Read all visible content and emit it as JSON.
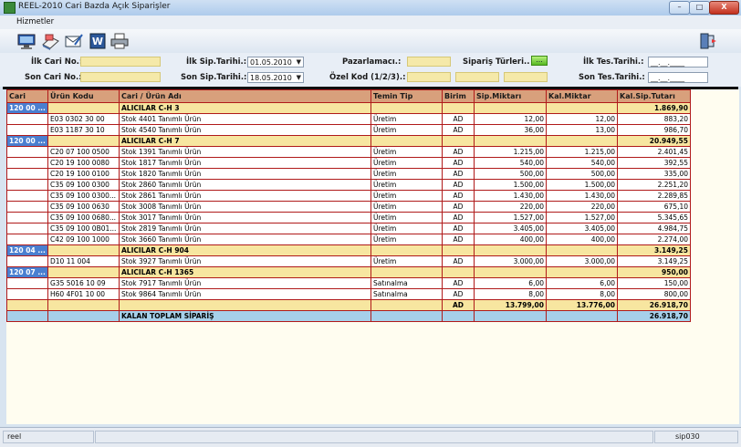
{
  "window": {
    "title": "REEL-2010 Cari Bazda Açık Siparişler",
    "min": "–",
    "max": "□",
    "close": "X"
  },
  "menu": {
    "hizmetler": "Hizmetler"
  },
  "toolbar": {
    "icons": [
      "monitor-icon",
      "document-icon",
      "envelope-icon",
      "word-icon",
      "printer-icon"
    ],
    "right_icon": "exit-door-icon"
  },
  "filters": {
    "ilk_cari_label": "İlk Cari No.:",
    "ilk_cari_value": "__ __ ____",
    "son_cari_label": "Son Cari No.:",
    "son_cari_value": "__ __ ____",
    "ilk_sip_label": "İlk Sip.Tarihi.:",
    "ilk_sip_value": "01.05.2010",
    "son_sip_label": "Son Sip.Tarihi.:",
    "son_sip_value": "18.05.2010",
    "pazarlamaci_label": "Pazarlamacı.:",
    "pazarlamaci_value": "__ __",
    "siparis_turleri_label": "Sipariş Türleri..",
    "siparis_turleri_btn": "...",
    "ozel_kod_label": "Özel Kod (1/2/3).:",
    "ozel_kod_values": [
      "____",
      "____",
      "____"
    ],
    "ilk_tes_label": "İlk Tes.Tarihi.:",
    "ilk_tes_value": "__.__.____",
    "son_tes_label": "Son Tes.Tarihi.:",
    "son_tes_value": "__.__.____"
  },
  "table": {
    "columns": [
      "Cari",
      "Ürün Kodu",
      "Cari / Ürün Adı",
      "Temin Tip",
      "Birim",
      "Sip.Miktarı",
      "Kal.Miktar",
      "Kal.Sip.Tutarı"
    ],
    "rows": [
      {
        "type": "group",
        "cari": "120 00 ...",
        "kod": "",
        "ad": "ALICILAR C-H 3",
        "temin": "",
        "birim": "",
        "sip": "",
        "kal": "",
        "tutar": "1.869,90"
      },
      {
        "type": "item",
        "cari": "",
        "kod": "E03 0302 30 00",
        "ad": "Stok 4401 Tanımlı Ürün",
        "temin": "Üretim",
        "birim": "AD",
        "sip": "12,00",
        "kal": "12,00",
        "tutar": "883,20"
      },
      {
        "type": "item",
        "cari": "",
        "kod": "E03 1187 30 10",
        "ad": "Stok 4540 Tanımlı Ürün",
        "temin": "Üretim",
        "birim": "AD",
        "sip": "36,00",
        "kal": "13,00",
        "tutar": "986,70"
      },
      {
        "type": "group",
        "cari": "120 00 ...",
        "kod": "",
        "ad": "ALICILAR C-H 7",
        "temin": "",
        "birim": "",
        "sip": "",
        "kal": "",
        "tutar": "20.949,55"
      },
      {
        "type": "item",
        "cari": "",
        "kod": "C20 07 100 0500",
        "ad": "Stok 1391 Tanımlı Ürün",
        "temin": "Üretim",
        "birim": "AD",
        "sip": "1.215,00",
        "kal": "1.215,00",
        "tutar": "2.401,45"
      },
      {
        "type": "item",
        "cari": "",
        "kod": "C20 19 100 0080",
        "ad": "Stok 1817 Tanımlı Ürün",
        "temin": "Üretim",
        "birim": "AD",
        "sip": "540,00",
        "kal": "540,00",
        "tutar": "392,55"
      },
      {
        "type": "item",
        "cari": "",
        "kod": "C20 19 100 0100",
        "ad": "Stok 1820 Tanımlı Ürün",
        "temin": "Üretim",
        "birim": "AD",
        "sip": "500,00",
        "kal": "500,00",
        "tutar": "335,00"
      },
      {
        "type": "item",
        "cari": "",
        "kod": "C35 09 100 0300",
        "ad": "Stok 2860 Tanımlı Ürün",
        "temin": "Üretim",
        "birim": "AD",
        "sip": "1.500,00",
        "kal": "1.500,00",
        "tutar": "2.251,20"
      },
      {
        "type": "item",
        "cari": "",
        "kod": "C35 09 100 0300...",
        "ad": "Stok 2861 Tanımlı Ürün",
        "temin": "Üretim",
        "birim": "AD",
        "sip": "1.430,00",
        "kal": "1.430,00",
        "tutar": "2.289,85"
      },
      {
        "type": "item",
        "cari": "",
        "kod": "C35 09 100 0630",
        "ad": "Stok 3008 Tanımlı Ürün",
        "temin": "Üretim",
        "birim": "AD",
        "sip": "220,00",
        "kal": "220,00",
        "tutar": "675,10"
      },
      {
        "type": "item",
        "cari": "",
        "kod": "C35 09 100 0680...",
        "ad": "Stok 3017 Tanımlı Ürün",
        "temin": "Üretim",
        "birim": "AD",
        "sip": "1.527,00",
        "kal": "1.527,00",
        "tutar": "5.345,65"
      },
      {
        "type": "item",
        "cari": "",
        "kod": "C35 09 100 0B01...",
        "ad": "Stok 2819 Tanımlı Ürün",
        "temin": "Üretim",
        "birim": "AD",
        "sip": "3.405,00",
        "kal": "3.405,00",
        "tutar": "4.984,75"
      },
      {
        "type": "item",
        "cari": "",
        "kod": "C42 09 100 1000",
        "ad": "Stok 3660 Tanımlı Ürün",
        "temin": "Üretim",
        "birim": "AD",
        "sip": "400,00",
        "kal": "400,00",
        "tutar": "2.274,00"
      },
      {
        "type": "group",
        "cari": "120 04 ...",
        "kod": "",
        "ad": "ALICILAR C-H 904",
        "temin": "",
        "birim": "",
        "sip": "",
        "kal": "",
        "tutar": "3.149,25"
      },
      {
        "type": "item",
        "cari": "",
        "kod": "D10 11 004",
        "ad": "Stok 3927 Tanımlı Ürün",
        "temin": "Üretim",
        "birim": "AD",
        "sip": "3.000,00",
        "kal": "3.000,00",
        "tutar": "3.149,25"
      },
      {
        "type": "group",
        "cari": "120 07 ...",
        "kod": "",
        "ad": "ALICILAR C-H 1365",
        "temin": "",
        "birim": "",
        "sip": "",
        "kal": "",
        "tutar": "950,00"
      },
      {
        "type": "item",
        "cari": "",
        "kod": "G35 5016 10 09",
        "ad": "Stok 7917 Tanımlı Ürün",
        "temin": "Satınalma",
        "birim": "AD",
        "sip": "6,00",
        "kal": "6,00",
        "tutar": "150,00"
      },
      {
        "type": "item",
        "cari": "",
        "kod": "H60 4F01 10 00",
        "ad": "Stok 9864 Tanımlı Ürün",
        "temin": "Satınalma",
        "birim": "AD",
        "sip": "8,00",
        "kal": "8,00",
        "tutar": "800,00"
      },
      {
        "type": "total",
        "cari": "",
        "kod": "",
        "ad": "",
        "temin": "",
        "birim": "AD",
        "sip": "13.799,00",
        "kal": "13.776,00",
        "tutar": "26.918,70"
      },
      {
        "type": "grand",
        "cari": "",
        "kod": "",
        "ad": "KALAN TOPLAM SİPARİŞ",
        "temin": "",
        "birim": "",
        "sip": "",
        "kal": "",
        "tutar": "26.918,70"
      }
    ]
  },
  "status": {
    "left": "reel",
    "right": "sip030"
  }
}
